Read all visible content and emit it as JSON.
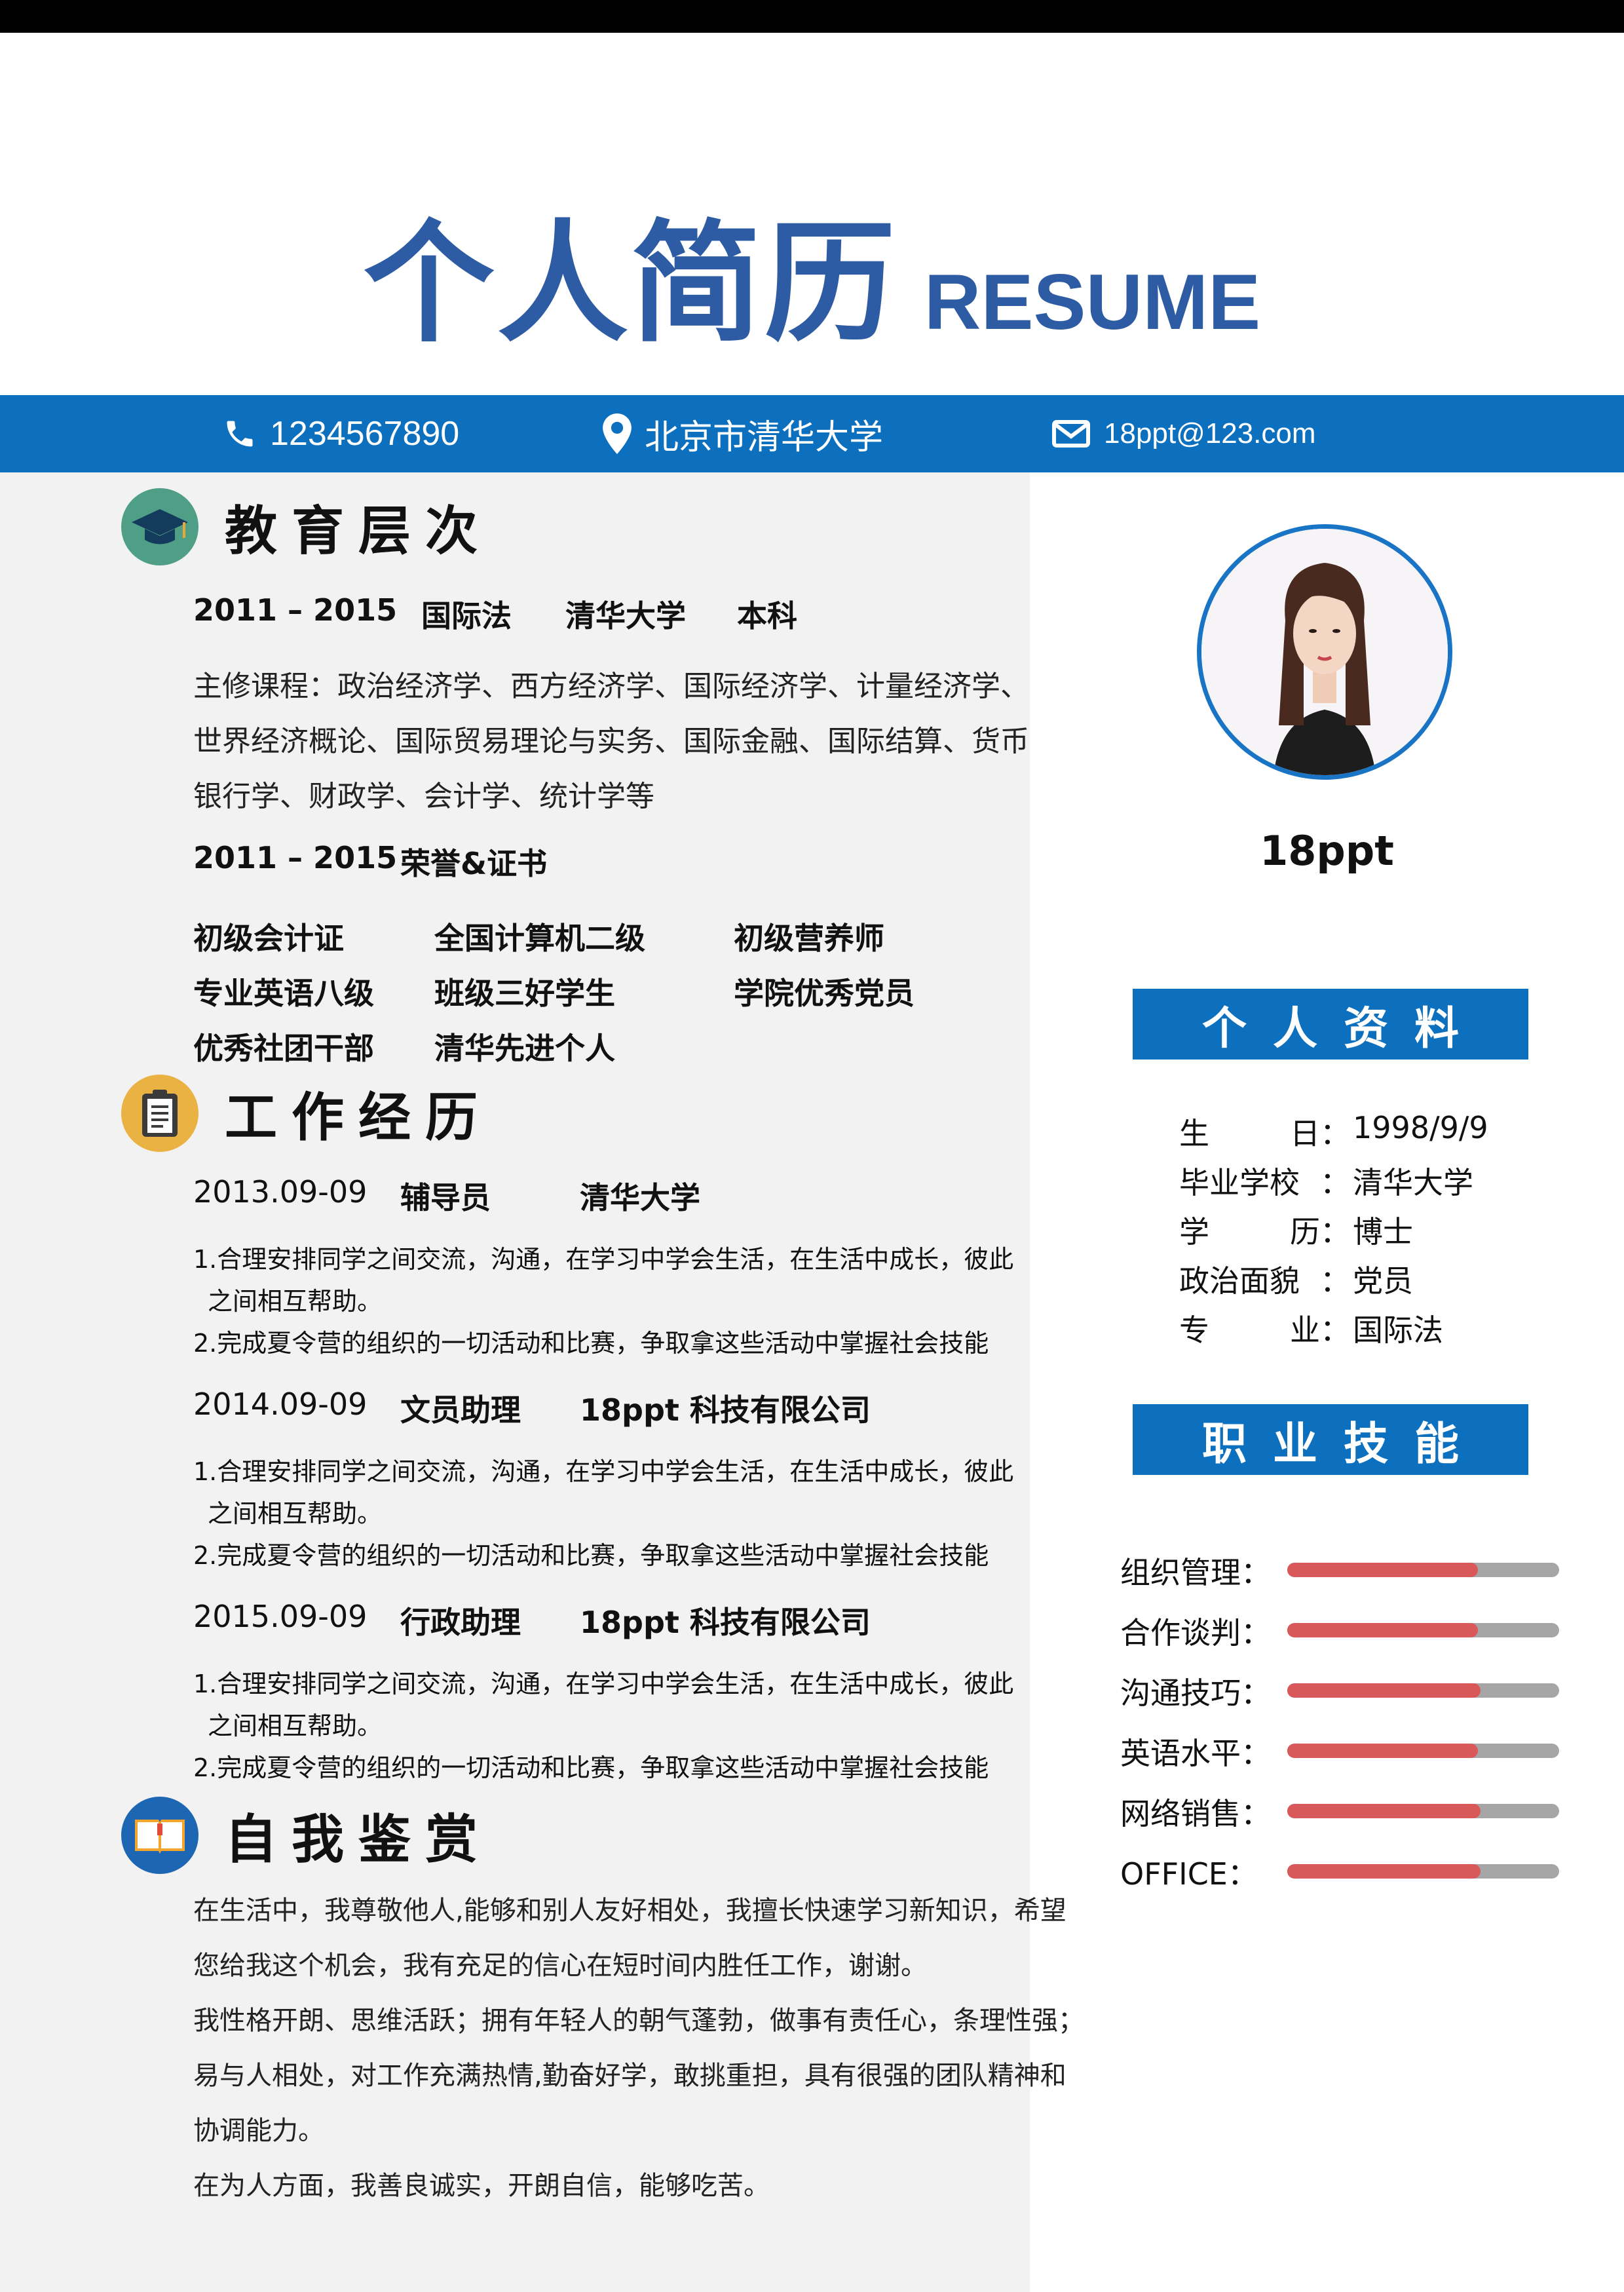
{
  "header": {
    "title_cn": "个人简历",
    "title_en": "RESUME"
  },
  "contact": {
    "phone": "1234567890",
    "address": "北京市清华大学",
    "email": "18ppt@123.com"
  },
  "education": {
    "title": "教育层次",
    "degree": {
      "years": "2011 – 2015",
      "major": "国际法",
      "school": "清华大学",
      "level": "本科"
    },
    "courses": [
      "主修课程：政治经济学、西方经济学、国际经济学、计量经济学、",
      "世界经济概论、国际贸易理论与实务、国际金融、国际结算、货币",
      "银行学、财政学、会计学、统计学等"
    ],
    "honors": {
      "years": "2011 – 2015",
      "title": "荣誉&证书"
    },
    "certificates": [
      "初级会计证",
      "全国计算机二级",
      "初级营养师",
      "专业英语八级",
      "班级三好学生",
      "学院优秀党员",
      "优秀社团干部",
      "清华先进个人"
    ]
  },
  "work": {
    "title": "工作经历",
    "jobs": [
      {
        "date": "2013.09-09",
        "role": "辅导员",
        "company": "清华大学",
        "duty1": "1.合理安排同学之间交流，沟通，在学习中学会生活，在生活中成长，彼此",
        "duty1b": "之间相互帮助。",
        "duty2": "2.完成夏令营的组织的一切活动和比赛，争取拿这些活动中掌握社会技能"
      },
      {
        "date": "2014.09-09",
        "role": "文员助理",
        "company": "18ppt 科技有限公司",
        "duty1": "1.合理安排同学之间交流，沟通，在学习中学会生活，在生活中成长，彼此",
        "duty1b": "之间相互帮助。",
        "duty2": "2.完成夏令营的组织的一切活动和比赛，争取拿这些活动中掌握社会技能"
      },
      {
        "date": "2015.09-09",
        "role": "行政助理",
        "company": "18ppt 科技有限公司",
        "duty1": "1.合理安排同学之间交流，沟通，在学习中学会生活，在生活中成长，彼此",
        "duty1b": "之间相互帮助。",
        "duty2": "2.完成夏令营的组织的一切活动和比赛，争取拿这些活动中掌握社会技能"
      }
    ]
  },
  "self": {
    "title": "自我鉴赏",
    "lines": [
      "在生活中，我尊敬他人,能够和别人友好相处，我擅长快速学习新知识，希望",
      "您给我这个机会，我有充足的信心在短时间内胜任工作，谢谢。",
      "我性格开朗、思维活跃；拥有年轻人的朝气蓬勃，做事有责任心，条理性强；",
      "易与人相处，对工作充满热情,勤奋好学，敢挑重担，具有很强的团队精神和",
      "协调能力。",
      "在为人方面，我善良诚实，开朗自信，能够吃苦。"
    ]
  },
  "profile": {
    "name": "18ppt",
    "info_title": "个人资料",
    "info": [
      {
        "l1": "生",
        "l2": "日",
        "value": "1998/9/9"
      },
      {
        "l1": "毕业学校",
        "l2": "",
        "value": "清华大学"
      },
      {
        "l1": "学",
        "l2": "历",
        "value": "博士"
      },
      {
        "l1": "政治面貌",
        "l2": "",
        "value": "党员"
      },
      {
        "l1": "专",
        "l2": "业",
        "value": "国际法"
      }
    ],
    "colon": "：",
    "skills_title": "职业技能",
    "skills": [
      {
        "label": "组织管理：",
        "level": 0.7
      },
      {
        "label": "合作谈判：",
        "level": 0.7
      },
      {
        "label": "沟通技巧：",
        "level": 0.71
      },
      {
        "label": "英语水平：",
        "level": 0.7
      },
      {
        "label": "网络销售：",
        "level": 0.71
      },
      {
        "label": "OFFICE：",
        "level": 0.71
      }
    ]
  },
  "colors": {
    "brand_blue": "#0c70bf",
    "title_blue": "#2e5ca4",
    "skill_fill": "#d9595b",
    "skill_track": "#a6a6a6"
  }
}
